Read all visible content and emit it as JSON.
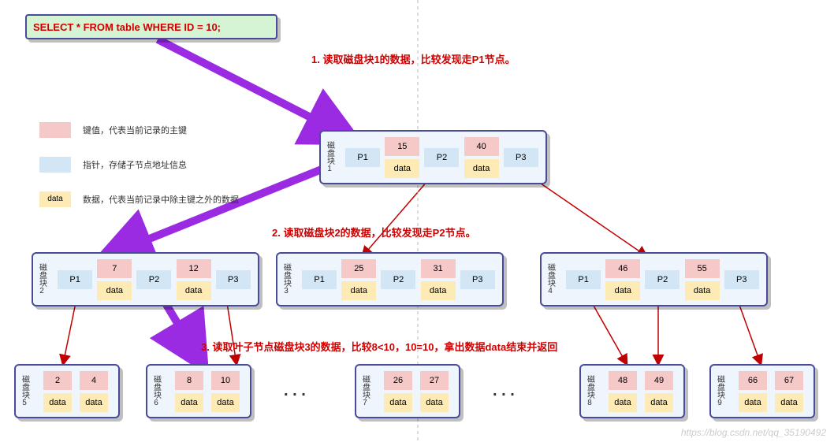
{
  "sql": "SELECT * FROM table WHERE ID = 10;",
  "legend": {
    "key": "键值，代表当前记录的主键",
    "ptr": "指针，存储子节点地址信息",
    "data_swatch": "data",
    "data": "数据，代表当前记录中除主键之外的数据"
  },
  "annotations": {
    "step1": "1. 读取磁盘块1的数据，比较发现走P1节点。",
    "step2": "2. 读取磁盘块2的数据，比较发现走P2节点。",
    "step3": "3. 读取叶子节点磁盘块3的数据，比较8<10，10=10，拿出数据data结束并返回"
  },
  "common": {
    "P1": "P1",
    "P2": "P2",
    "P3": "P3",
    "data": "data"
  },
  "blocks": {
    "b1": {
      "label": "磁盘块1",
      "k1": "15",
      "k2": "40"
    },
    "b2": {
      "label": "磁盘块2",
      "k1": "7",
      "k2": "12"
    },
    "b3": {
      "label": "磁盘块3",
      "k1": "25",
      "k2": "31"
    },
    "b4": {
      "label": "磁盘块4",
      "k1": "46",
      "k2": "55"
    },
    "b5": {
      "label": "磁盘块5",
      "k1": "2",
      "k2": "4"
    },
    "b6": {
      "label": "磁盘块6",
      "k1": "8",
      "k2": "10"
    },
    "b7": {
      "label": "磁盘块7",
      "k1": "26",
      "k2": "27"
    },
    "b8": {
      "label": "磁盘块8",
      "k1": "48",
      "k2": "49"
    },
    "b9": {
      "label": "磁盘块9",
      "k1": "66",
      "k2": "67"
    }
  },
  "dots": ". . .",
  "watermark": "https://blog.csdn.net/qq_35190492"
}
